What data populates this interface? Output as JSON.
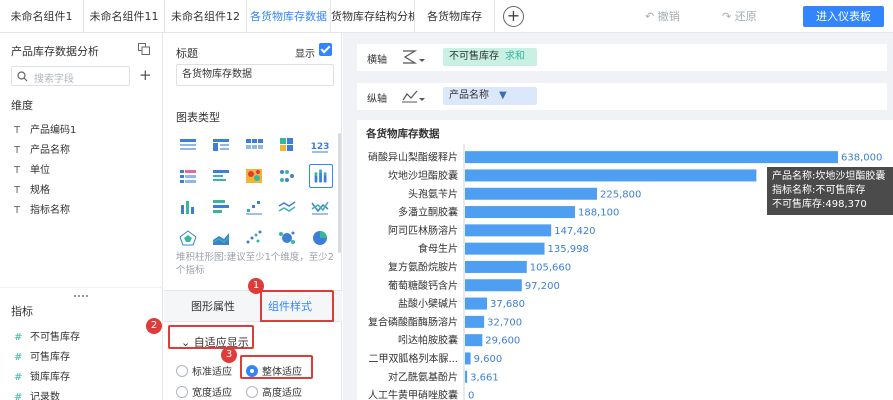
{
  "tabs": [
    {
      "label": "未命名组件1",
      "active": false
    },
    {
      "label": "未命名组件11",
      "active": false
    },
    {
      "label": "未命名组件12",
      "active": false
    },
    {
      "label": "各货物库存数据",
      "active": true
    },
    {
      "label": "货物库存结构分析",
      "active": false
    },
    {
      "label": "各货物库存",
      "active": false
    }
  ],
  "toolbar": {
    "undo_label": "撤销",
    "redo_label": "还原",
    "enter_dashboard_label": "进入仪表板"
  },
  "left_panel": {
    "title": "产品库存数据分析",
    "search_placeholder": "搜索字段",
    "dimension_header": "维度",
    "dimensions": [
      {
        "icon": "T",
        "label": "产品编码1"
      },
      {
        "icon": "T",
        "label": "产品名称"
      },
      {
        "icon": "T",
        "label": "单位"
      },
      {
        "icon": "T",
        "label": "规格"
      },
      {
        "icon": "T",
        "label": "指标名称"
      }
    ],
    "measure_header": "指标",
    "measures": [
      {
        "icon": "#",
        "label": "不可售库存"
      },
      {
        "icon": "#",
        "label": "可售库存"
      },
      {
        "icon": "#",
        "label": "锁库库存"
      },
      {
        "icon": "#",
        "label": "记录数"
      }
    ]
  },
  "config_panel": {
    "title_label": "标题",
    "show_label": "显示",
    "title_value": "各货物库存数据",
    "chart_type_label": "图表类型",
    "chart_type_hint": "堆积柱形图:建议至少1个维度，至少2个指标",
    "subtab_shape": "图形属性",
    "subtab_style": "组件样式",
    "adaptive_label": "自适应显示",
    "radio_options": [
      {
        "label": "标准适应",
        "selected": false
      },
      {
        "label": "整体适应",
        "selected": true
      },
      {
        "label": "宽度适应",
        "selected": false
      },
      {
        "label": "高度适应",
        "selected": false
      }
    ],
    "step_badges": [
      "1",
      "2",
      "3"
    ]
  },
  "axes": {
    "x_label": "横轴",
    "x_field": "不可售库存",
    "x_field_agg": "求和",
    "y_label": "纵轴",
    "y_field": "产品名称"
  },
  "tooltip": {
    "line1": "产品名称:坎地沙坦酯胶囊",
    "line2": "指标名称:不可售库存",
    "line3": "不可售库存:498,370"
  },
  "colors": {
    "accent": "#3385ff",
    "bar": "#4e9ff2",
    "badge": "#e03b3b",
    "measure_icon": "#3ab5a0"
  },
  "chart_data": {
    "type": "bar",
    "orientation": "horizontal",
    "title": "各货物库存数据",
    "categories": [
      "硝酸异山梨酯缓释片",
      "坎地沙坦酯胶囊",
      "头孢氨苄片",
      "多潘立酮胶囊",
      "阿司匹林肠溶片",
      "食母生片",
      "复方氨酚烷胺片",
      "葡萄糖酸钙含片",
      "盐酸小檗碱片",
      "复合磷酸酯酶肠溶片",
      "吲达帕胺胶囊",
      "二甲双胍格列本脲...",
      "对乙酰氨基酚片",
      "人工牛黄甲硝唑胶囊"
    ],
    "values": [
      638000,
      498370,
      225800,
      188100,
      147420,
      135998,
      105660,
      97200,
      37680,
      32700,
      29600,
      9600,
      3661,
      0
    ],
    "value_labels": [
      "638,000",
      "",
      "225,800",
      "188,100",
      "147,420",
      "135,998",
      "105,660",
      "97,200",
      "37,680",
      "32,700",
      "29,600",
      "9,600",
      "3,661",
      "0"
    ],
    "xlim": [
      0,
      638000
    ],
    "grid": false,
    "legend": "none"
  }
}
